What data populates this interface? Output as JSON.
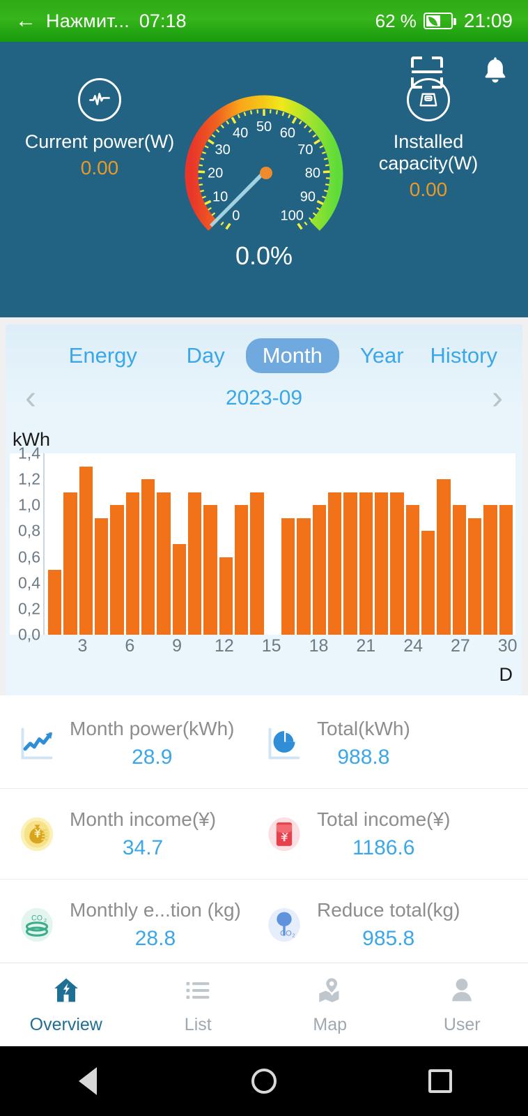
{
  "statusbar": {
    "back_icon": "back-arrow-icon",
    "app_name": "Нажмит...",
    "app_time": "07:18",
    "battery_pct": "62 %",
    "battery_icon": "battery-eco-icon",
    "clock": "21:09"
  },
  "appbar": {
    "scan_icon": "scan-icon",
    "bell_icon": "bell-icon",
    "left_stat": {
      "icon": "pulse-circle-icon",
      "label": "Current power(W)",
      "value": "0.00"
    },
    "right_stat": {
      "icon": "panel-circle-icon",
      "label": "Installed capacity(W)",
      "value": "0.00"
    },
    "gauge": {
      "percent_text": "0.0%",
      "value": 0,
      "min": 0,
      "max": 100,
      "ticks": [
        "0",
        "10",
        "20",
        "30",
        "40",
        "50",
        "60",
        "70",
        "80",
        "90",
        "100"
      ],
      "needle_color": "#a8d8e6",
      "hub_color": "#f08a2a"
    },
    "accent_value_color": "#e89a28",
    "background_color": "#226383"
  },
  "energy": {
    "title_tab": "Energy",
    "range_tabs": [
      {
        "label": "Day",
        "active": false
      },
      {
        "label": "Month",
        "active": true
      },
      {
        "label": "Year",
        "active": false
      },
      {
        "label": "History",
        "active": false
      }
    ],
    "active_tab_color": "#6fa9dd",
    "link_color": "#3ba7e8",
    "prev_icon": "chevron-left-icon",
    "next_icon": "chevron-right-icon",
    "date_label": "2023-09"
  },
  "chart_data": {
    "type": "bar",
    "title": "",
    "xlabel": "D",
    "ylabel": "kWh",
    "ylim": [
      0,
      1.4
    ],
    "grid": false,
    "bar_color": "#f2721a",
    "ytick_labels": [
      "0,0",
      "0,2",
      "0,4",
      "0,6",
      "0,8",
      "1,0",
      "1,2",
      "1,4"
    ],
    "ytick_values": [
      0,
      0.2,
      0.4,
      0.6,
      0.8,
      1.0,
      1.2,
      1.4
    ],
    "xtick_labels": [
      "3",
      "6",
      "9",
      "12",
      "15",
      "18",
      "21",
      "24",
      "27",
      "30"
    ],
    "xtick_positions": [
      3,
      6,
      9,
      12,
      15,
      18,
      21,
      24,
      27,
      30
    ],
    "categories": [
      "1",
      "2",
      "3",
      "4",
      "5",
      "6",
      "7",
      "8",
      "9",
      "10",
      "11",
      "12",
      "13",
      "14",
      "15",
      "16",
      "17",
      "18",
      "19",
      "20",
      "21",
      "22",
      "23",
      "24",
      "25",
      "26",
      "27",
      "28",
      "29",
      "30"
    ],
    "values": [
      0.5,
      1.1,
      1.3,
      0.9,
      1.0,
      1.1,
      1.2,
      1.1,
      0.7,
      1.1,
      1.0,
      0.6,
      1.0,
      1.1,
      0.0,
      0.9,
      0.9,
      1.0,
      1.1,
      1.1,
      1.1,
      1.1,
      1.1,
      1.0,
      0.8,
      1.2,
      1.0,
      0.9,
      1.0,
      1.0
    ]
  },
  "stats": {
    "rows": [
      [
        {
          "icon": "line-chart-icon",
          "label": "Month power(kWh)",
          "value": "28.9"
        },
        {
          "icon": "pie-chart-icon",
          "label": "Total(kWh)",
          "value": "988.8"
        }
      ],
      [
        {
          "icon": "money-bag-icon",
          "label": "Month income(¥)",
          "value": "34.7"
        },
        {
          "icon": "red-envelope-icon",
          "label": "Total income(¥)",
          "value": "1186.6"
        }
      ],
      [
        {
          "icon": "co2-stack-icon",
          "label": "Monthly e...tion (kg)",
          "value": "28.8"
        },
        {
          "icon": "co2-tree-icon",
          "label": "Reduce total(kg)",
          "value": "985.8"
        }
      ]
    ],
    "value_color": "#3ba7e8",
    "label_color": "#8d8d8d"
  },
  "bottomnav": {
    "items": [
      {
        "icon": "home-bolt-icon",
        "label": "Overview",
        "active": true
      },
      {
        "icon": "list-icon",
        "label": "List",
        "active": false
      },
      {
        "icon": "map-pin-icon",
        "label": "Map",
        "active": false
      },
      {
        "icon": "user-icon",
        "label": "User",
        "active": false
      }
    ],
    "active_color": "#1f6f94",
    "inactive_color": "#bfc7cc"
  },
  "sysnav": {
    "back_icon": "system-back-icon",
    "home_icon": "system-home-icon",
    "recents_icon": "system-recents-icon"
  }
}
